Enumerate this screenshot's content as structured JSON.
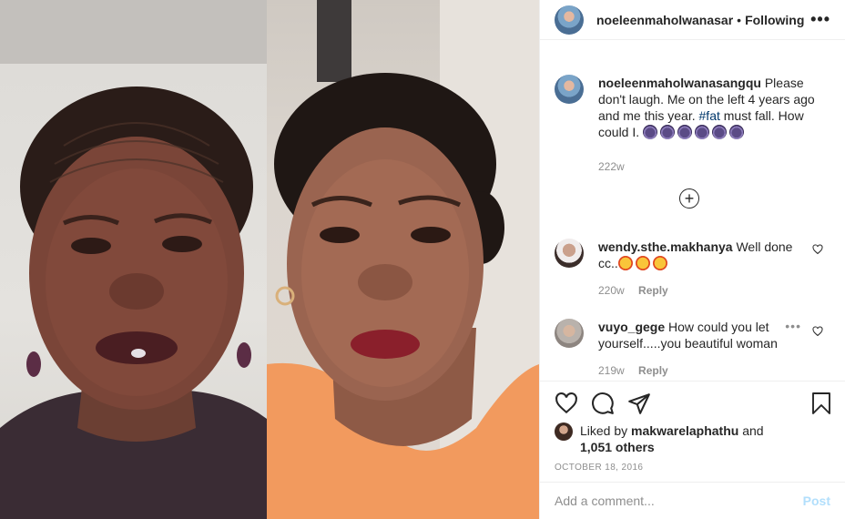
{
  "post": {
    "author": "noeleenmaholwanasar",
    "separator": "•",
    "follow_status": "Following",
    "more_icon": "more-horizontal-icon"
  },
  "caption": {
    "user": "noeleenmaholwanasangqu",
    "text_before": "Please don't laugh. Me on the left 4 years ago and me this year.",
    "hashtag": "#fat",
    "text_after": "must fall. How could I.",
    "emoji_count": 6,
    "time": "222w"
  },
  "load_more_icon": "plus-circle-icon",
  "comments": [
    {
      "user": "wendy.sthe.makhanya",
      "text": "Well done cc..",
      "emoji_count": 3,
      "time": "220w",
      "reply": "Reply"
    },
    {
      "user": "vuyo_gege",
      "text": "How could you let yourself.....you beautiful woman",
      "time": "219w",
      "reply": "Reply"
    }
  ],
  "likes": {
    "prefix": "Liked by",
    "user": "makwarelaphathu",
    "and": "and",
    "others": "1,051 others"
  },
  "date": "OCTOBER 18, 2016",
  "composer": {
    "placeholder": "Add a comment...",
    "post_label": "Post"
  },
  "colors": {
    "text": "#262626",
    "muted": "#8e8e8e",
    "link": "#00376b",
    "post_disabled": "#b2dffc",
    "border": "#efefef"
  }
}
